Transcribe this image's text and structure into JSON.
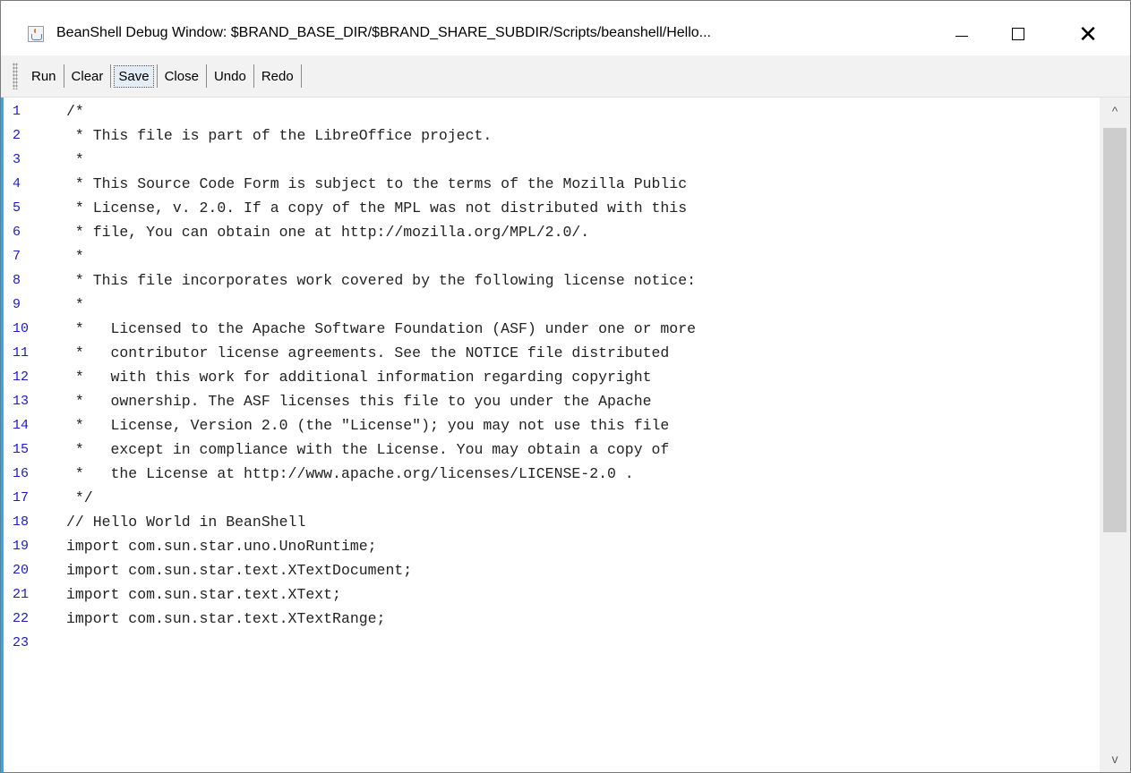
{
  "window": {
    "title": "BeanShell Debug Window: $BRAND_BASE_DIR/$BRAND_SHARE_SUBDIR/Scripts/beanshell/Hello...",
    "app_icon": "java-cup-icon",
    "minimize_glyph": "—",
    "maximize_glyph": "☐",
    "close_glyph": "✕"
  },
  "toolbar": {
    "run_label": "Run",
    "clear_label": "Clear",
    "save_label": "Save",
    "close_label": "Close",
    "undo_label": "Undo",
    "redo_label": "Redo"
  },
  "editor": {
    "lines": [
      {
        "num": "1",
        "text": "/*"
      },
      {
        "num": "2",
        "text": " * This file is part of the LibreOffice project."
      },
      {
        "num": "3",
        "text": " *"
      },
      {
        "num": "4",
        "text": " * This Source Code Form is subject to the terms of the Mozilla Public"
      },
      {
        "num": "5",
        "text": " * License, v. 2.0. If a copy of the MPL was not distributed with this"
      },
      {
        "num": "6",
        "text": " * file, You can obtain one at http://mozilla.org/MPL/2.0/."
      },
      {
        "num": "7",
        "text": " *"
      },
      {
        "num": "8",
        "text": " * This file incorporates work covered by the following license notice:"
      },
      {
        "num": "9",
        "text": " *"
      },
      {
        "num": "10",
        "text": " *   Licensed to the Apache Software Foundation (ASF) under one or more"
      },
      {
        "num": "11",
        "text": " *   contributor license agreements. See the NOTICE file distributed"
      },
      {
        "num": "12",
        "text": " *   with this work for additional information regarding copyright"
      },
      {
        "num": "13",
        "text": " *   ownership. The ASF licenses this file to you under the Apache"
      },
      {
        "num": "14",
        "text": " *   License, Version 2.0 (the \"License\"); you may not use this file"
      },
      {
        "num": "15",
        "text": " *   except in compliance with the License. You may obtain a copy of"
      },
      {
        "num": "16",
        "text": " *   the License at http://www.apache.org/licenses/LICENSE-2.0 ."
      },
      {
        "num": "17",
        "text": " */"
      },
      {
        "num": "18",
        "text": "// Hello World in BeanShell"
      },
      {
        "num": "19",
        "text": "import com.sun.star.uno.UnoRuntime;"
      },
      {
        "num": "20",
        "text": "import com.sun.star.text.XTextDocument;"
      },
      {
        "num": "21",
        "text": "import com.sun.star.text.XText;"
      },
      {
        "num": "22",
        "text": "import com.sun.star.text.XTextRange;"
      },
      {
        "num": "23",
        "text": ""
      }
    ]
  },
  "scrollbar": {
    "up_glyph": "^",
    "down_glyph": "v",
    "position_fraction": 0.0
  }
}
